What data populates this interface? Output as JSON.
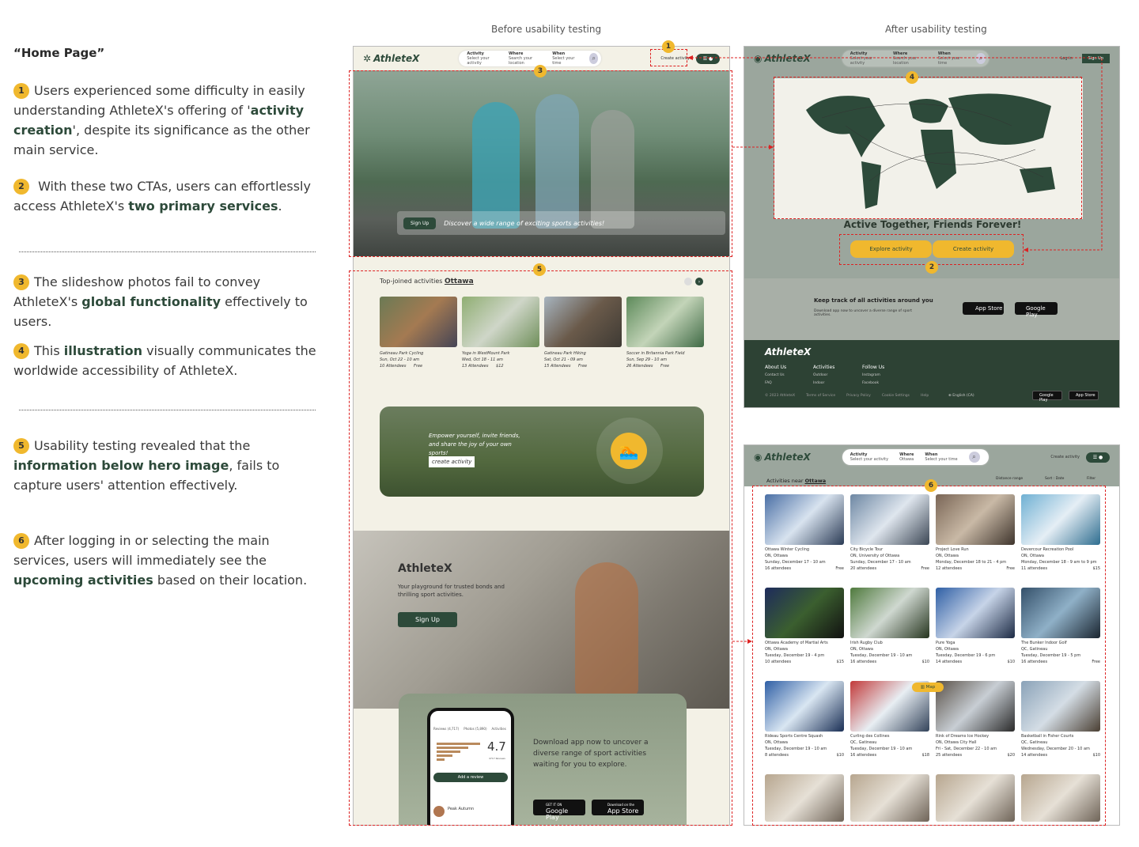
{
  "notes": {
    "title": "“Home Page”",
    "items": [
      {
        "num": "1",
        "pre": "Users experienced some difficulty in easily understanding AthleteX's offering of '",
        "bold": "activity creation",
        "post": "', despite its significance as the other main service."
      },
      {
        "num": "2",
        "pre": " With these two CTAs, users can effortlessly access AthleteX's ",
        "bold": "two primary services",
        "post": "."
      },
      {
        "num": "3",
        "pre": "The slideshow photos fail to convey AthleteX's ",
        "bold": "global functionality",
        "post": " effectively to users."
      },
      {
        "num": "4",
        "pre": "This ",
        "bold": "illustration",
        "post": " visually communicates the worldwide accessibility of AthleteX."
      },
      {
        "num": "5",
        "pre": "Usability testing revealed that the ",
        "bold": "information below hero image",
        "post": ", fails to capture users' attention effectively."
      },
      {
        "num": "6",
        "pre": "After logging in or selecting the main services, users will immediately see the ",
        "bold": "upcoming activities",
        "post": " based on their location."
      }
    ]
  },
  "headers": {
    "before": "Before usability testing",
    "after": "After usability testing"
  },
  "nav": {
    "logo": "AthleteX",
    "activity": "Activity",
    "activity_sub": "Select your activity",
    "where": "Where",
    "where_sub": "Search your location",
    "when": "When",
    "when_sub": "Select your time",
    "create": "Create activity",
    "login": "Log in",
    "signup": "Sign Up"
  },
  "before": {
    "hero_signup": "Sign Up",
    "hero_text": "Discover a wide range of exciting sports activities!",
    "top_joined": "Top-joined activities",
    "city": "Ottawa",
    "cards": [
      {
        "name": "Gatineau Park Cycling",
        "date": "Sun, Oct 22 - 10 am",
        "att": "10 Attendees",
        "price": "Free"
      },
      {
        "name": "Yoga in WestMount Park",
        "date": "Wed, Oct 18 - 11 am",
        "att": "13 Attendees",
        "price": "$12"
      },
      {
        "name": "Gatineau Park Hiking",
        "date": "Sat, Oct 21 - 09 am",
        "att": "15 Attendees",
        "price": "Free"
      },
      {
        "name": "Soccer in Britannia Park Field",
        "date": "Sun, Sep 29 - 10 am",
        "att": "26 Attendees",
        "price": "Free"
      }
    ],
    "empower": "Empower yourself, invite friends, and share the joy of your own sports!",
    "create_btn": "create activity",
    "brand": "AthleteX",
    "brand_sub": "Your playground for trusted bonds and thrilling sport activities.",
    "brand_signup": "Sign Up",
    "phone_tabs": [
      "Reviews (4,717)",
      "Photos (5,890)",
      "Activities"
    ],
    "rating": "4.7",
    "rating_sub": "4717 Reviews",
    "add_review": "Add a review",
    "reviewer": "Peak Autumn",
    "download": "Download app now to uncover a diverse range of sport activities waiting for you to explore.",
    "google": "Google Play",
    "google_pre": "GET IT ON",
    "apple": "App Store",
    "apple_pre": "Download on the"
  },
  "after1": {
    "tagline": "Active Together, Friends Forever!",
    "explore": "Explore activity",
    "create": "Create activity",
    "keep": "Keep track of all activities around you",
    "keep_sub": "Download app now to uncover a diverse range of sport activities.",
    "footer_logo": "AthleteX",
    "cols": [
      {
        "h": "About Us",
        "items": [
          "Contact Us",
          "FAQ"
        ]
      },
      {
        "h": "Activities",
        "items": [
          "Outdoor",
          "Indoor"
        ]
      },
      {
        "h": "Follow Us",
        "items": [
          "Instagram",
          "Facebook"
        ]
      }
    ],
    "legal": [
      "© 2023 AthleteX",
      "Terms of Service",
      "Privacy Policy",
      "Cookie Settings",
      "Help"
    ],
    "lang": "English (CA)"
  },
  "after2": {
    "near": "Activities near",
    "city": "Ottawa",
    "distance": "Distance range",
    "sort": "Sort : Date",
    "filter": "Filter",
    "map": "Map",
    "cards": [
      {
        "name": "Ottawa Winter Cycling",
        "loc": "ON, Ottawa",
        "date": "Sunday, December 17 - 10 am",
        "att": "16 attendees",
        "price": "Free"
      },
      {
        "name": "City Bicycle Tour",
        "loc": "ON, University of Ottawa",
        "date": "Sunday, December 17 - 10 am",
        "att": "20 attendees",
        "price": "Free"
      },
      {
        "name": "Project Love Run",
        "loc": "ON, Ottawa",
        "date": "Monday, December 18 to 21 - 4 pm",
        "att": "12 attendees",
        "price": "Free"
      },
      {
        "name": "Devercour Recreation Pool",
        "loc": "ON, Ottawa",
        "date": "Monday, December 18 - 9 am to 9 pm",
        "att": "11 attendees",
        "price": "$15"
      },
      {
        "name": "Ottawa Academy of Martial Arts",
        "loc": "ON, Ottawa",
        "date": "Tuesday, December 19 - 4 pm",
        "att": "10 attendees",
        "price": "$15"
      },
      {
        "name": "Irish Rugby Club",
        "loc": "ON, Ottawa",
        "date": "Tuesday, December 19 - 10 am",
        "att": "16 attendees",
        "price": "$10"
      },
      {
        "name": "Pure Yoga",
        "loc": "ON, Ottawa",
        "date": "Tuesday, December 19 - 6 pm",
        "att": "14 attendees",
        "price": "$10"
      },
      {
        "name": "The Bunker Indoor Golf",
        "loc": "QC, Gatineau",
        "date": "Tuesday, December 19 - 5 pm",
        "att": "16 attendees",
        "price": "Free"
      },
      {
        "name": "Rideau Sports Centre Squash",
        "loc": "ON, Ottawa",
        "date": "Tuesday, December 19 - 10 am",
        "att": "8 attendees",
        "price": "$10"
      },
      {
        "name": "Curling des Collines",
        "loc": "QC, Gatineau",
        "date": "Tuesday, December 19 - 10 am",
        "att": "16 attendees",
        "price": "$18"
      },
      {
        "name": "Rink of Dreams Ice Hockey",
        "loc": "ON, Ottawa City Hall",
        "date": "Fri - Sat, December 22 - 10 am",
        "att": "25 attendees",
        "price": "$20"
      },
      {
        "name": "Basketball in Fisher Courts",
        "loc": "QC, Gatineau",
        "date": "Wednesday, December 20 - 10 am",
        "att": "14 attendees",
        "price": "$10"
      }
    ]
  },
  "colors": {
    "brand_green": "#2d4a3a",
    "accent_yellow": "#f0b82e",
    "annotation_red": "#d22"
  }
}
